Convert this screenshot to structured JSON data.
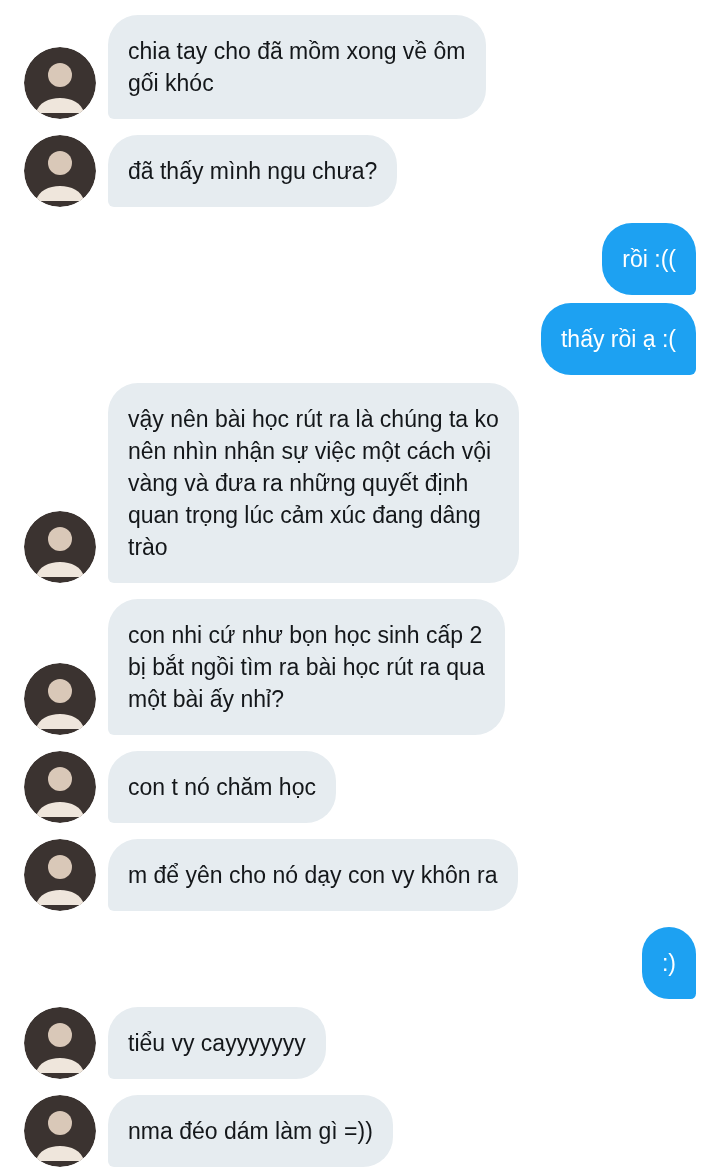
{
  "messages": [
    {
      "kind": "incoming",
      "lines": [
        "chia tay cho đã mồm xong về ôm",
        "gối khóc"
      ]
    },
    {
      "kind": "incoming",
      "lines": [
        "đã thấy mình ngu chưa?"
      ]
    },
    {
      "kind": "outgoing",
      "lines": [
        "rồi :(("
      ]
    },
    {
      "kind": "outgoing",
      "lines": [
        "thấy rồi ạ :("
      ]
    },
    {
      "kind": "incoming",
      "lines": [
        "vậy nên bài học rút ra là chúng ta ko",
        "nên nhìn nhận sự việc một cách vội",
        "vàng và đưa ra những quyết định",
        "quan trọng lúc cảm xúc đang dâng",
        "trào"
      ]
    },
    {
      "kind": "incoming",
      "lines": [
        "con nhi cứ như bọn học sinh cấp 2",
        "bị bắt ngồi tìm ra bài học rút ra qua",
        "một bài ấy nhỉ?"
      ]
    },
    {
      "kind": "incoming",
      "lines": [
        "con t nó chăm học"
      ]
    },
    {
      "kind": "incoming",
      "lines": [
        "m để yên cho nó dạy con vy khôn ra"
      ]
    },
    {
      "kind": "outgoing",
      "lines": [
        ":)"
      ]
    },
    {
      "kind": "incoming",
      "lines": [
        "tiểu vy cayyyyyyy"
      ]
    },
    {
      "kind": "incoming",
      "lines": [
        "nma đéo dám làm gì =))"
      ]
    }
  ]
}
